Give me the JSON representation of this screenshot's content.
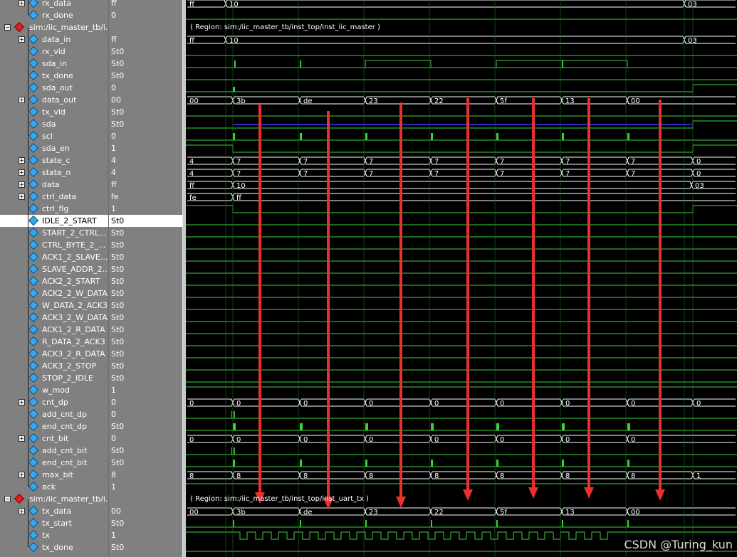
{
  "signals": [
    {
      "name": "rx_data",
      "value": "ff",
      "icon": "diamond-blue",
      "expand": true,
      "indent": 1
    },
    {
      "name": "rx_done",
      "value": "0",
      "icon": "diamond-blue",
      "expand": false,
      "indent": 1
    },
    {
      "name": "sim:/iic_master_tb/i...",
      "value": "",
      "icon": "diamond-red",
      "expand": true,
      "indent": 0,
      "group": true,
      "minus": true
    },
    {
      "name": "data_in",
      "value": "ff",
      "icon": "diamond-blue",
      "expand": true,
      "indent": 1
    },
    {
      "name": "rx_vld",
      "value": "St0",
      "icon": "diamond-blue",
      "expand": false,
      "indent": 1
    },
    {
      "name": "sda_in",
      "value": "St0",
      "icon": "diamond-blue",
      "expand": false,
      "indent": 1
    },
    {
      "name": "tx_done",
      "value": "St0",
      "icon": "diamond-blue",
      "expand": false,
      "indent": 1
    },
    {
      "name": "sda_out",
      "value": "0",
      "icon": "diamond-blue",
      "expand": false,
      "indent": 1
    },
    {
      "name": "data_out",
      "value": "00",
      "icon": "diamond-blue",
      "expand": true,
      "indent": 1
    },
    {
      "name": "tx_vld",
      "value": "St0",
      "icon": "diamond-blue",
      "expand": false,
      "indent": 1
    },
    {
      "name": "sda",
      "value": "St0",
      "icon": "diamond-blue",
      "expand": false,
      "indent": 1
    },
    {
      "name": "scl",
      "value": "0",
      "icon": "diamond-blue",
      "expand": false,
      "indent": 1
    },
    {
      "name": "sda_en",
      "value": "1",
      "icon": "diamond-blue",
      "expand": false,
      "indent": 1
    },
    {
      "name": "state_c",
      "value": "4",
      "icon": "diamond-blue",
      "expand": true,
      "indent": 1
    },
    {
      "name": "state_n",
      "value": "4",
      "icon": "diamond-blue",
      "expand": true,
      "indent": 1
    },
    {
      "name": "data",
      "value": "ff",
      "icon": "diamond-blue",
      "expand": true,
      "indent": 1
    },
    {
      "name": "ctrl_data",
      "value": "fe",
      "icon": "diamond-blue",
      "expand": true,
      "indent": 1
    },
    {
      "name": "ctrl_flg",
      "value": "1",
      "icon": "diamond-blue",
      "expand": false,
      "indent": 1
    },
    {
      "name": "IDLE_2_START",
      "value": "St0",
      "icon": "diamond-blue",
      "expand": false,
      "indent": 1,
      "selected": true
    },
    {
      "name": "START_2_CTRL...",
      "value": "St0",
      "icon": "diamond-blue",
      "expand": false,
      "indent": 1
    },
    {
      "name": "CTRL_BYTE_2_...",
      "value": "St0",
      "icon": "diamond-blue",
      "expand": false,
      "indent": 1
    },
    {
      "name": "ACK1_2_SLAVE...",
      "value": "St0",
      "icon": "diamond-blue",
      "expand": false,
      "indent": 1
    },
    {
      "name": "SLAVE_ADDR_2...",
      "value": "St0",
      "icon": "diamond-blue",
      "expand": false,
      "indent": 1
    },
    {
      "name": "ACK2_2_START",
      "value": "St0",
      "icon": "diamond-blue",
      "expand": false,
      "indent": 1
    },
    {
      "name": "ACK2_2_W_DATA",
      "value": "St0",
      "icon": "diamond-blue",
      "expand": false,
      "indent": 1
    },
    {
      "name": "W_DATA_2_ACK3",
      "value": "St0",
      "icon": "diamond-blue",
      "expand": false,
      "indent": 1
    },
    {
      "name": "ACK3_2_W_DATA",
      "value": "St0",
      "icon": "diamond-blue",
      "expand": false,
      "indent": 1
    },
    {
      "name": "ACK1_2_R_DATA",
      "value": "St0",
      "icon": "diamond-blue",
      "expand": false,
      "indent": 1
    },
    {
      "name": "R_DATA_2_ACK3",
      "value": "St0",
      "icon": "diamond-blue",
      "expand": false,
      "indent": 1
    },
    {
      "name": "ACK3_2_R_DATA",
      "value": "St0",
      "icon": "diamond-blue",
      "expand": false,
      "indent": 1
    },
    {
      "name": "ACK3_2_STOP",
      "value": "St0",
      "icon": "diamond-blue",
      "expand": false,
      "indent": 1
    },
    {
      "name": "STOP_2_IDLE",
      "value": "St0",
      "icon": "diamond-blue",
      "expand": false,
      "indent": 1
    },
    {
      "name": "w_mod",
      "value": "1",
      "icon": "diamond-blue",
      "expand": false,
      "indent": 1
    },
    {
      "name": "cnt_dp",
      "value": "0",
      "icon": "diamond-blue",
      "expand": true,
      "indent": 1
    },
    {
      "name": "add_cnt_dp",
      "value": "0",
      "icon": "diamond-blue",
      "expand": false,
      "indent": 1
    },
    {
      "name": "end_cnt_dp",
      "value": "St0",
      "icon": "diamond-blue",
      "expand": false,
      "indent": 1
    },
    {
      "name": "cnt_bit",
      "value": "0",
      "icon": "diamond-blue",
      "expand": true,
      "indent": 1
    },
    {
      "name": "add_cnt_bit",
      "value": "St0",
      "icon": "diamond-blue",
      "expand": false,
      "indent": 1
    },
    {
      "name": "end_cnt_bit",
      "value": "St0",
      "icon": "diamond-blue",
      "expand": false,
      "indent": 1
    },
    {
      "name": "max_bit",
      "value": "8",
      "icon": "diamond-blue",
      "expand": true,
      "indent": 1
    },
    {
      "name": "ack",
      "value": "1",
      "icon": "diamond-blue",
      "expand": false,
      "indent": 1
    },
    {
      "name": "sim:/iic_master_tb/i...",
      "value": "",
      "icon": "diamond-red",
      "expand": true,
      "indent": 0,
      "group": true,
      "minus": true
    },
    {
      "name": "tx_data",
      "value": "00",
      "icon": "diamond-blue",
      "expand": true,
      "indent": 1
    },
    {
      "name": "tx_start",
      "value": "St0",
      "icon": "diamond-blue",
      "expand": false,
      "indent": 1
    },
    {
      "name": "tx",
      "value": "1",
      "icon": "diamond-blue",
      "expand": false,
      "indent": 1
    },
    {
      "name": "tx_done",
      "value": "St0",
      "icon": "diamond-blue",
      "expand": false,
      "indent": 1
    }
  ],
  "region_labels": {
    "iic_master": "( Region: sim:/iic_master_tb/inst_top/inst_iic_master )",
    "uart_tx": "( Region: sim:/iic_master_tb/inst_top/inst_uart_tx )"
  },
  "bus_values": {
    "rx_data": [
      "ff",
      "10",
      "03"
    ],
    "data_in": [
      "ff",
      "10",
      "03"
    ],
    "data_out": [
      "00",
      "3b",
      "de",
      "23",
      "22",
      "5f",
      "13",
      "00"
    ],
    "state_c": [
      "4",
      "7",
      "7",
      "7",
      "7",
      "7",
      "7",
      "7",
      "0"
    ],
    "state_n": [
      "4",
      "7",
      "7",
      "7",
      "7",
      "7",
      "7",
      "7",
      "0"
    ],
    "data": [
      "ff",
      "10",
      "03"
    ],
    "ctrl_data": [
      "fe",
      "ff"
    ],
    "cnt_dp": [
      "0",
      "0",
      "0",
      "0",
      "0",
      "0",
      "0",
      "0",
      "0"
    ],
    "cnt_bit": [
      "0",
      "0",
      "0",
      "0",
      "0",
      "0",
      "0",
      "0"
    ],
    "max_bit": [
      "8",
      "8",
      "8",
      "8",
      "8",
      "8",
      "8",
      "8",
      "1"
    ],
    "tx_data": [
      "00",
      "3b",
      "de",
      "23",
      "22",
      "5f",
      "13",
      "00"
    ]
  },
  "watermark": "CSDN @Turing_kun",
  "colors": {
    "wave": "#3cd23c",
    "bus": "#ffffff",
    "arrow": "#e8312f",
    "sda_line": "#2a3cff",
    "cursor": "#39e639"
  }
}
